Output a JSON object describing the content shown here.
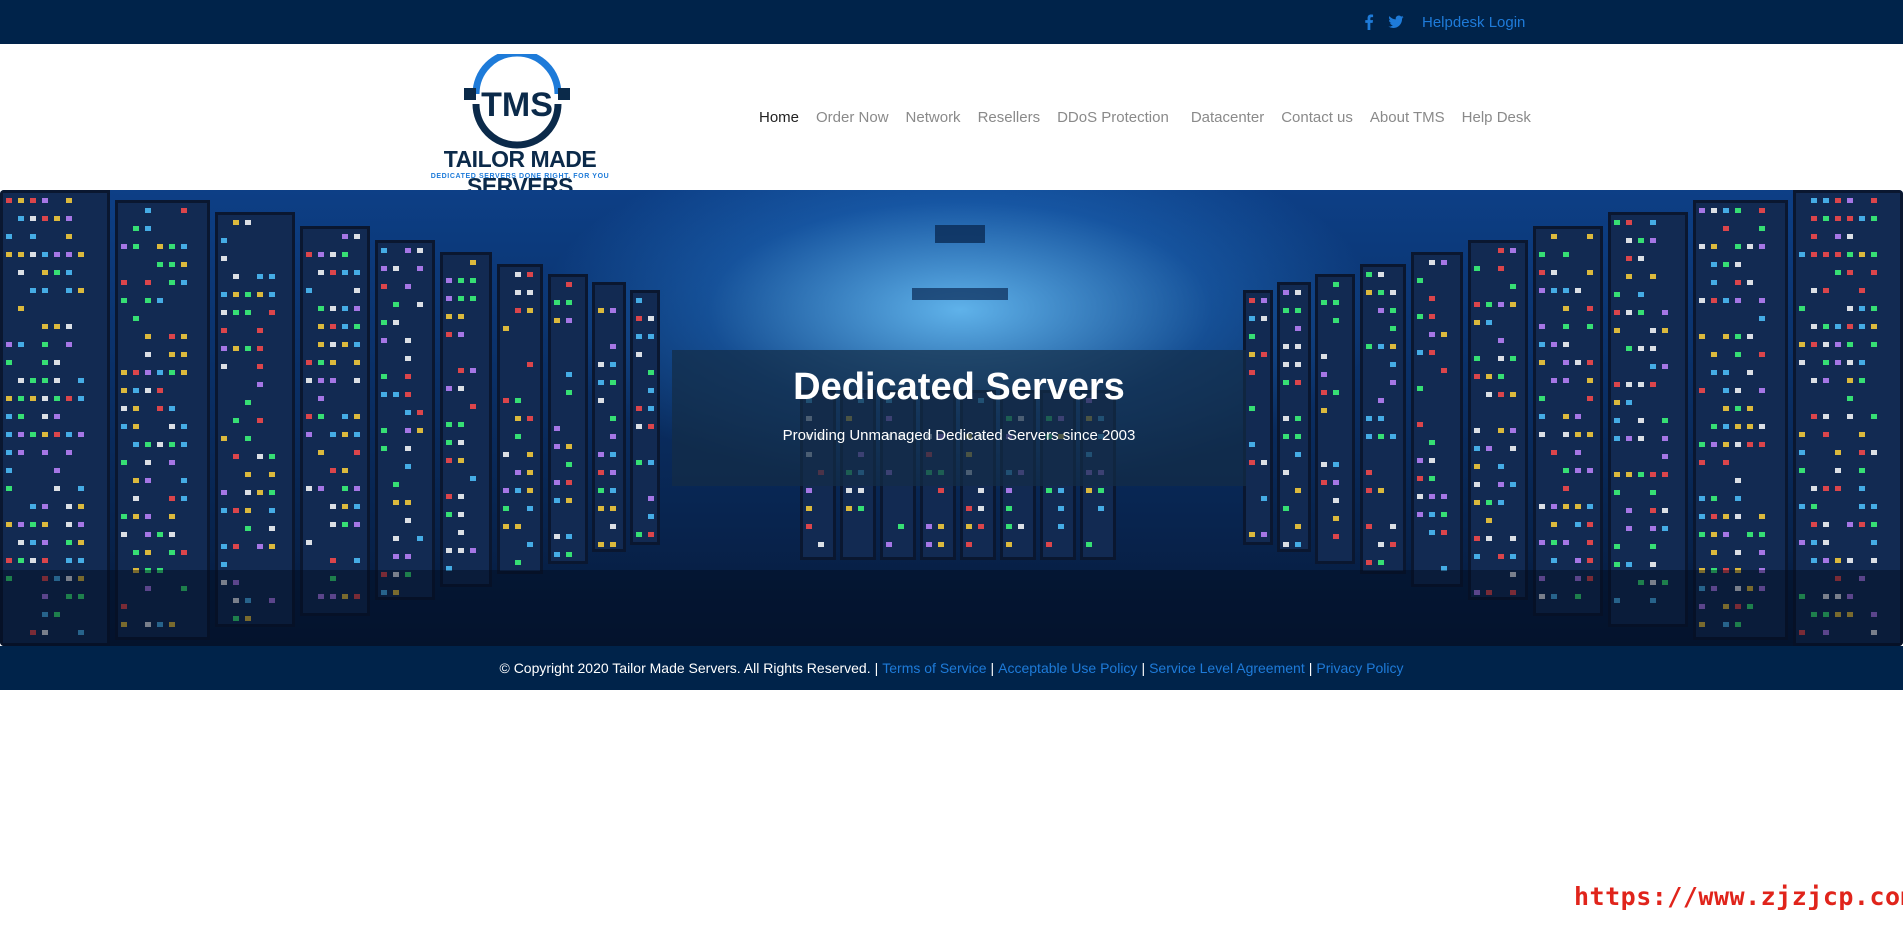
{
  "topbar": {
    "icons": [
      "facebook-icon",
      "twitter-icon"
    ],
    "helpdesk_login": "Helpdesk Login"
  },
  "logo": {
    "mark_letters": "TMS",
    "name": "TAILOR MADE SERVERS",
    "tagline": "DEDICATED SERVERS DONE RIGHT. FOR YOU"
  },
  "nav": {
    "items": [
      {
        "label": "Home",
        "active": true
      },
      {
        "label": "Order Now"
      },
      {
        "label": "Network"
      },
      {
        "label": "Resellers"
      },
      {
        "label": "DDoS Protection"
      },
      {
        "label": "Datacenter"
      },
      {
        "label": "Contact us"
      },
      {
        "label": "About TMS"
      },
      {
        "label": "Help Desk"
      }
    ]
  },
  "hero": {
    "title": "Dedicated Servers",
    "subtitle": "Providing Unmanaged Dedicated Servers since 2003"
  },
  "footer": {
    "copyright": "© Copyright 2020 Tailor Made Servers. All Rights Reserved.",
    "separator": "|",
    "links": [
      "Terms of Service",
      "Acceptable Use Policy",
      "Service Level Agreement",
      "Privacy Policy"
    ]
  },
  "watermark": "https://www.zjzjcp.com",
  "colors": {
    "navy": "#00234a",
    "link_blue": "#1e7bd9",
    "watermark_red": "#e0241b"
  }
}
